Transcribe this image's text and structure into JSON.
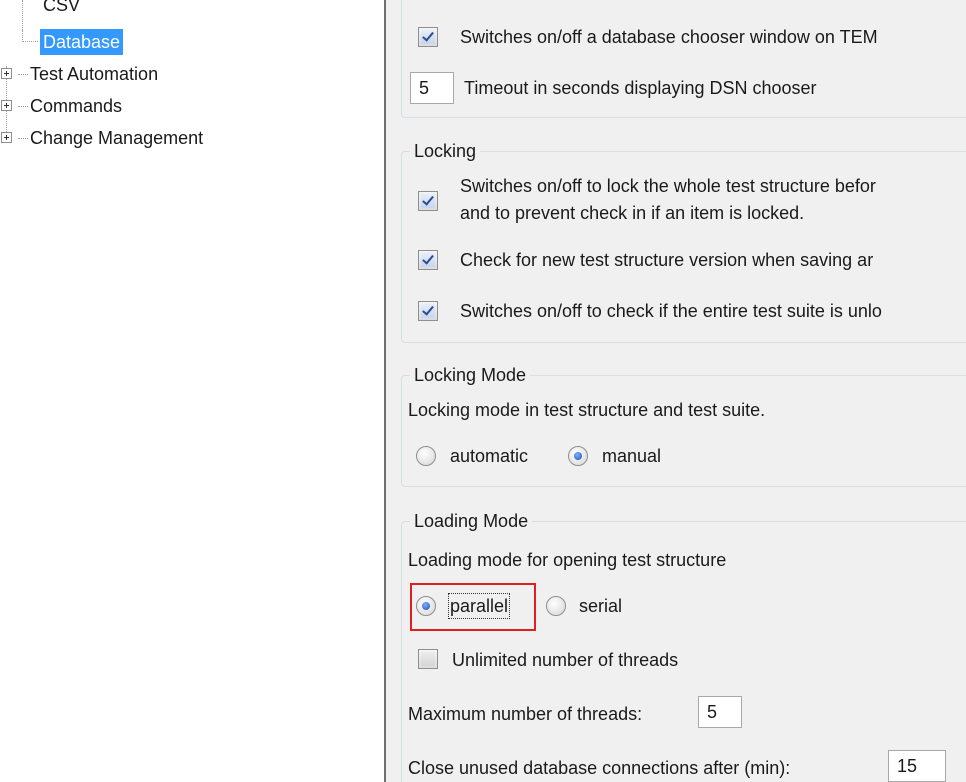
{
  "tree": {
    "items": [
      {
        "label": "CSV",
        "selected": false,
        "expandable": false
      },
      {
        "label": "Database",
        "selected": true,
        "expandable": false
      },
      {
        "label": "Test Automation",
        "selected": false,
        "expandable": true
      },
      {
        "label": "Commands",
        "selected": false,
        "expandable": true
      },
      {
        "label": "Change Management",
        "selected": false,
        "expandable": true
      }
    ]
  },
  "database": {
    "chooser_checked": true,
    "chooser_label": "Switches on/off a database chooser window on TEM",
    "timeout_value": "5",
    "timeout_label": "Timeout in seconds displaying DSN chooser"
  },
  "locking": {
    "title": "Locking",
    "lock_checked": true,
    "lock_label_line1": "Switches on/off to lock the whole test structure befor",
    "lock_label_line2": "and to prevent check in if an item is locked.",
    "version_checked": true,
    "version_label": "Check for new test structure version when saving ar",
    "suite_checked": true,
    "suite_label": "Switches on/off to check if the entire test suite is unlo"
  },
  "locking_mode": {
    "title": "Locking Mode",
    "description": "Locking mode in test structure and test suite.",
    "automatic_label": "automatic",
    "manual_label": "manual",
    "selected": "manual"
  },
  "loading_mode": {
    "title": "Loading Mode",
    "description": "Loading mode for opening test structure",
    "parallel_label": "parallel",
    "serial_label": "serial",
    "selected": "parallel",
    "unlimited_checked": false,
    "unlimited_label": "Unlimited number of threads",
    "max_threads_label": "Maximum number of threads:",
    "max_threads_value": "5",
    "close_connections_label": "Close unused database connections after (min):",
    "close_connections_value": "15"
  },
  "colors": {
    "selection": "#3399ff",
    "panel_bg": "#f0f0f0",
    "group_border": "#d5dfe5",
    "highlight": "#e02020"
  }
}
